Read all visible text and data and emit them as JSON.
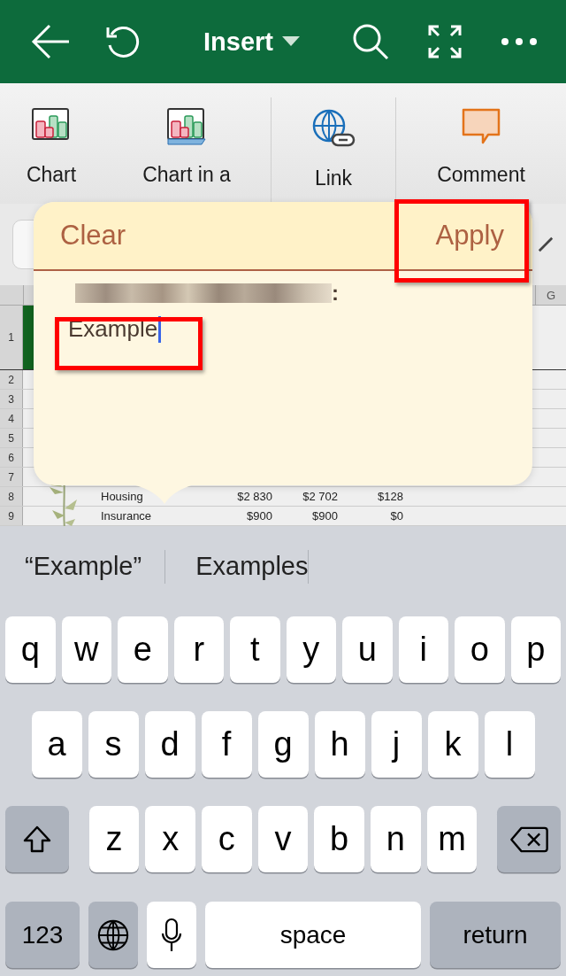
{
  "toolbar": {
    "title": "Insert"
  },
  "ribbon": {
    "items": [
      {
        "kind": "chart",
        "label": "Chart"
      },
      {
        "kind": "chart_sheet",
        "label": "Chart in a"
      },
      {
        "kind": "link",
        "label": "Link"
      },
      {
        "kind": "comment",
        "label": "Comment"
      }
    ]
  },
  "sheet": {
    "columns": [
      {
        "label": "G"
      }
    ],
    "rows": [
      {
        "number": "1",
        "cells": []
      },
      {
        "number": "2",
        "cells": []
      },
      {
        "number": "3",
        "cells": []
      },
      {
        "number": "4",
        "cells": []
      },
      {
        "number": "5",
        "cells": []
      },
      {
        "number": "6",
        "cells": []
      },
      {
        "number": "7",
        "cells": []
      },
      {
        "number": "8",
        "cells": [
          "Housing",
          "$2 830",
          "$2 702",
          "$128"
        ]
      },
      {
        "number": "9",
        "cells": [
          "Insurance",
          "$900",
          "$900",
          "$0"
        ]
      }
    ]
  },
  "popover": {
    "clear": "Clear",
    "apply": "Apply",
    "label_suffix": ":",
    "value": "Example"
  },
  "keyboard": {
    "suggestions": [
      "“Example”",
      "Examples"
    ],
    "key_rows": [
      {
        "keys": [
          {
            "kind": "letter",
            "label": "q"
          },
          {
            "kind": "letter",
            "label": "w"
          },
          {
            "kind": "letter",
            "label": "e"
          },
          {
            "kind": "letter",
            "label": "r"
          },
          {
            "kind": "letter",
            "label": "t"
          },
          {
            "kind": "letter",
            "label": "y"
          },
          {
            "kind": "letter",
            "label": "u"
          },
          {
            "kind": "letter",
            "label": "i"
          },
          {
            "kind": "letter",
            "label": "o"
          },
          {
            "kind": "letter",
            "label": "p"
          }
        ]
      },
      {
        "keys": [
          {
            "kind": "letter",
            "label": "a"
          },
          {
            "kind": "letter",
            "label": "s"
          },
          {
            "kind": "letter",
            "label": "d"
          },
          {
            "kind": "letter",
            "label": "f"
          },
          {
            "kind": "letter",
            "label": "g"
          },
          {
            "kind": "letter",
            "label": "h"
          },
          {
            "kind": "letter",
            "label": "j"
          },
          {
            "kind": "letter",
            "label": "k"
          },
          {
            "kind": "letter",
            "label": "l"
          }
        ]
      },
      {
        "keys": [
          {
            "kind": "shift"
          },
          {
            "kind": "letter",
            "label": "z"
          },
          {
            "kind": "letter",
            "label": "x"
          },
          {
            "kind": "letter",
            "label": "c"
          },
          {
            "kind": "letter",
            "label": "v"
          },
          {
            "kind": "letter",
            "label": "b"
          },
          {
            "kind": "letter",
            "label": "n"
          },
          {
            "kind": "letter",
            "label": "m"
          },
          {
            "kind": "backspace"
          }
        ]
      },
      {
        "keys": [
          {
            "kind": "mode",
            "label": "123"
          },
          {
            "kind": "globe"
          },
          {
            "kind": "mic"
          },
          {
            "kind": "space",
            "label": "space"
          },
          {
            "kind": "return",
            "label": "return"
          }
        ]
      }
    ]
  }
}
